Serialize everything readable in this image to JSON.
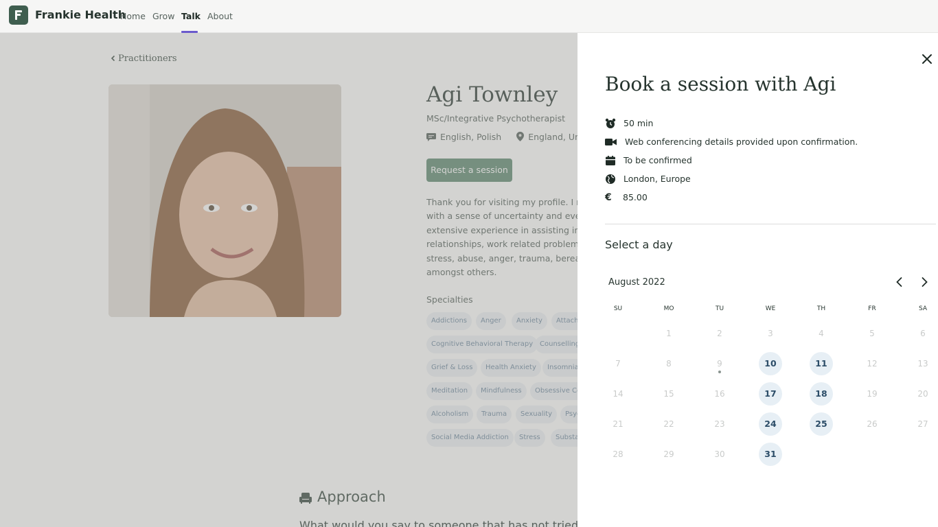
{
  "nav": {
    "brand": "Frankie Health",
    "links": [
      "Home",
      "Grow",
      "Talk",
      "About"
    ],
    "active": "Talk"
  },
  "profile": {
    "breadcrumb": "Practitioners",
    "name": "Agi Townley",
    "title": "MSc/Integrative Psychotherapist",
    "languages": "English, Polish",
    "location": "England, Unitec",
    "request_button": "Request a session",
    "bio_lines": [
      "Thank you for visiting my profile. I reall",
      "with a sense of uncertainty and even a",
      "extensive experience in assisting indivi",
      "relationships, work related problems ar",
      "stress, abuse, anger, trauma, bereavem",
      "amongst others."
    ],
    "specialties_title": "Specialties",
    "specialties": [
      "Addictions",
      "Anger",
      "Anxiety",
      "Attach",
      "Cognitive Behavioral Therapy",
      "Counselling",
      "Grief & Loss",
      "Health Anxiety",
      "Insomnia",
      "Meditation",
      "Mindfulness",
      "Obsessive Co",
      "Alcoholism",
      "Trauma",
      "Sexuality",
      "Psyc",
      "Social Media Addiction",
      "Stress",
      "Substa"
    ],
    "approach_title": "Approach",
    "approach_text": "What would you say to someone that has not tried th"
  },
  "booking": {
    "title": "Book a session with Agi",
    "details": [
      {
        "icon": "alarm-clock-icon",
        "text": "50 min"
      },
      {
        "icon": "video-camera-icon",
        "text": "Web conferencing details provided upon confirmation."
      },
      {
        "icon": "calendar-icon",
        "text": "To be confirmed"
      },
      {
        "icon": "globe-icon",
        "text": "London, Europe"
      },
      {
        "icon": "euro-icon",
        "text": "85.00"
      }
    ],
    "select_day_label": "Select a day",
    "calendar": {
      "month": "August 2022",
      "weekdays": [
        "SU",
        "MO",
        "TU",
        "WE",
        "TH",
        "FR",
        "SA"
      ],
      "first_weekday_index": 1,
      "days_in_month": 31,
      "available_days": [
        10,
        11,
        17,
        18,
        24,
        25,
        31
      ],
      "today": 9
    }
  },
  "colors": {
    "brand_green": "#3f5e4f",
    "accent_purple": "#6a5acd",
    "available_day_bg": "#e7eff5",
    "available_day_text": "#2c4d68",
    "chip_text": "#6e89a0"
  }
}
